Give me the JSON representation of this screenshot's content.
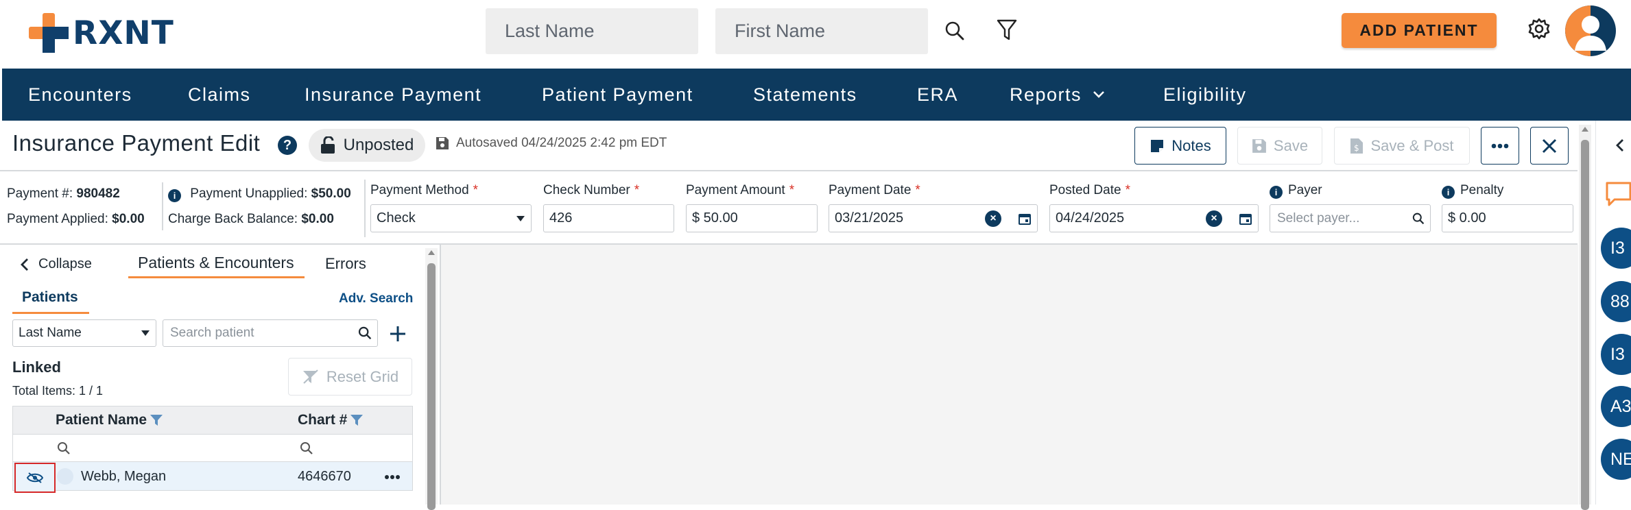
{
  "app": {
    "logo_text": "RXNT",
    "brand_orange": "#f58b3d",
    "brand_navy": "#0d3a5e"
  },
  "top": {
    "last_name_placeholder": "Last Name",
    "first_name_placeholder": "First Name",
    "search_icon": "search-icon",
    "filter_icon": "filter-icon",
    "add_patient_label": "ADD PATIENT",
    "settings_icon": "gear-icon",
    "avatar_icon": "user-avatar-icon"
  },
  "nav": {
    "items": [
      "Encounters",
      "Claims",
      "Insurance Payment",
      "Patient Payment",
      "Statements",
      "ERA",
      "Reports",
      "Eligibility"
    ]
  },
  "header": {
    "title": "Insurance Payment Edit",
    "status": "Unposted",
    "autosaved": "Autosaved 04/24/2025 2:42 pm EDT",
    "notes_label": "Notes",
    "save_label": "Save",
    "save_post_label": "Save & Post"
  },
  "payment": {
    "payment_no_label": "Payment #:",
    "payment_no": "980482",
    "applied_label": "Payment Applied:",
    "applied": "$0.00",
    "unapplied_label": "Payment Unapplied:",
    "unapplied": "$50.00",
    "chargeback_label": "Charge Back Balance:",
    "chargeback": "$0.00",
    "method_label": "Payment Method",
    "method_value": "Check",
    "check_label": "Check Number",
    "check_value": "426",
    "amount_label": "Payment Amount",
    "amount_value": "$ 50.00",
    "payment_date_label": "Payment Date",
    "payment_date_value": "03/21/2025",
    "posted_date_label": "Posted Date",
    "posted_date_value": "04/24/2025",
    "payer_label": "Payer",
    "payer_placeholder": "Select payer...",
    "penalty_label": "Penalty",
    "penalty_value": "$ 0.00"
  },
  "left": {
    "collapse_label": "Collapse",
    "tab_patients_encounters": "Patients & Encounters",
    "tab_errors": "Errors",
    "subtab_patients": "Patients",
    "adv_search": "Adv. Search",
    "search_by": "Last Name",
    "search_placeholder": "Search patient",
    "linked_title": "Linked",
    "total_items": "Total Items: 1 / 1",
    "reset_grid": "Reset Grid",
    "col_patient_name": "Patient Name",
    "col_chart": "Chart #",
    "rows": [
      {
        "name": "Webb, Megan",
        "chart": "4646670"
      }
    ]
  },
  "right_rail": {
    "circles": [
      "I3",
      "88",
      "I3",
      "A3",
      "NE"
    ]
  }
}
